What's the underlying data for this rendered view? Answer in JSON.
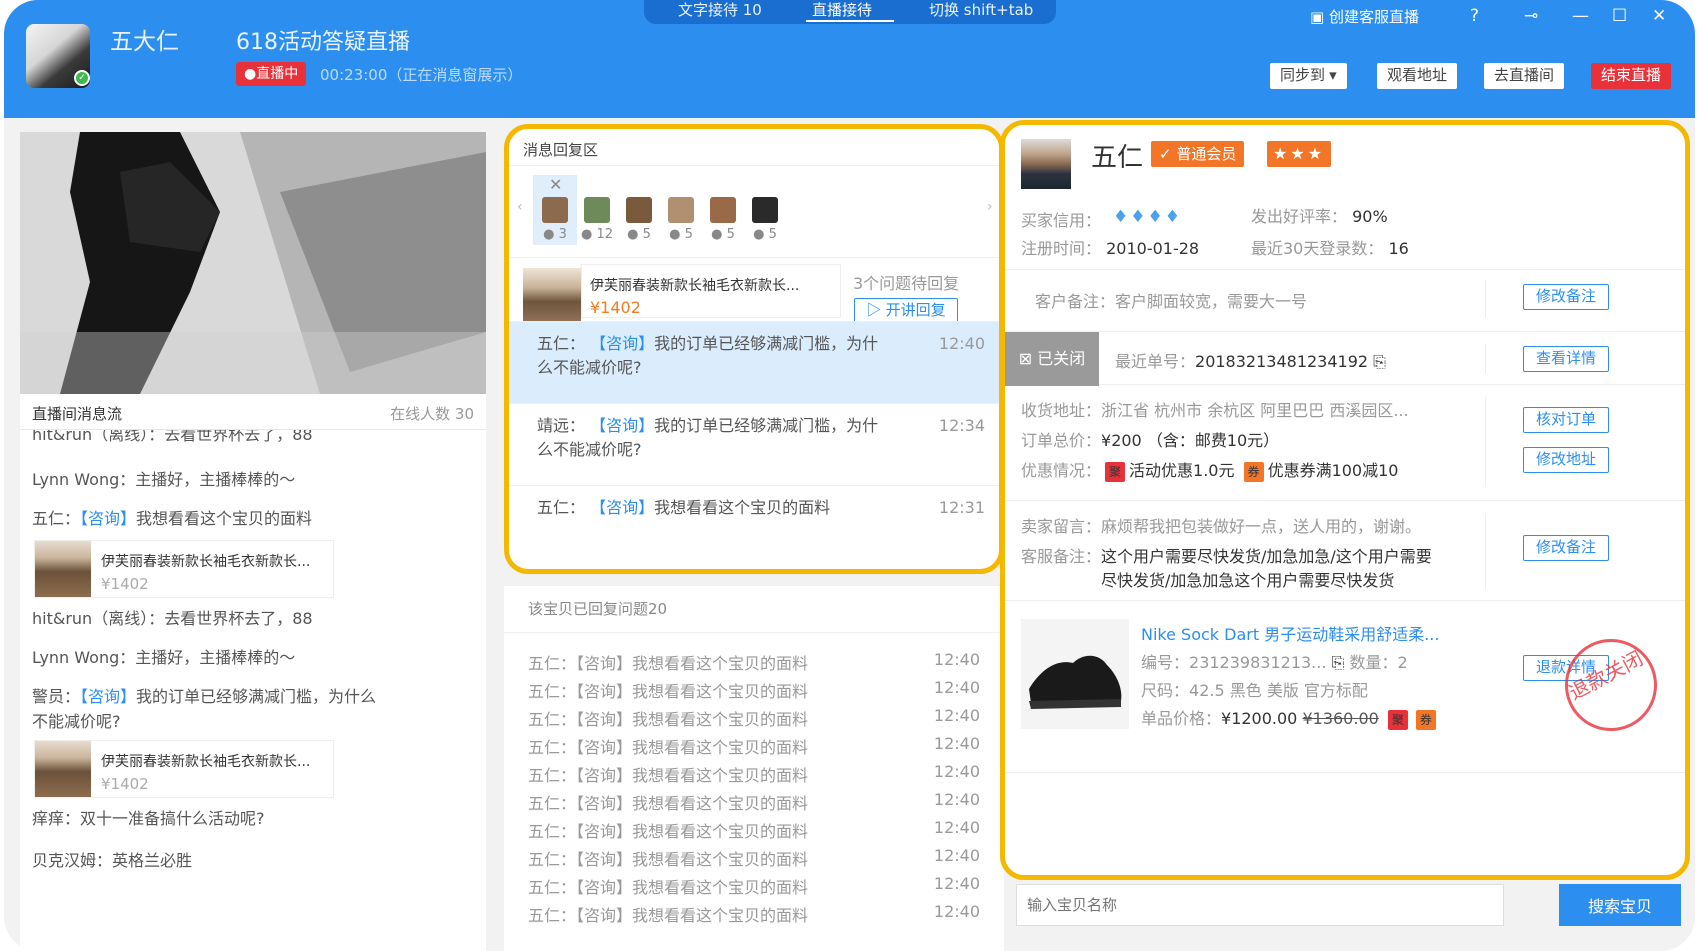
{
  "header": {
    "user_name": "五大仁",
    "live_title": "618活动答疑直播",
    "live_badge": "●直播中",
    "live_time": "00:23:00（正在消息窗展示）",
    "tabs": [
      {
        "label": "文字接待 10"
      },
      {
        "label": "直播接待"
      },
      {
        "label": "切换  shift+tab"
      }
    ],
    "create_live": "创建客服直播",
    "window_icons": [
      "help-icon",
      "pin-icon",
      "minimize-icon",
      "maximize-icon",
      "close-icon"
    ],
    "buttons": {
      "sync": "同步到 ▾",
      "watch": "观看地址",
      "go_room": "去直播间",
      "end": "结束直播"
    }
  },
  "left": {
    "feed_title": "直播间消息流",
    "online": "在线人数 30",
    "messages": [
      {
        "text": "hit&run（离线）：去看世界杯去了，88"
      },
      {
        "text": "Lynn Wong：主播好，主播棒棒的～"
      },
      {
        "user": "五仁：",
        "tag": "【咨询】",
        "text": "我想看看这个宝贝的面料"
      },
      {
        "text": "hit&run（离线）：去看世界杯去了，88"
      },
      {
        "text": "Lynn Wong：主播好，主播棒棒的～"
      },
      {
        "user": "警员：",
        "tag": "【咨询】",
        "text": "我的订单已经够满减门槛，为什么不能减价呢?"
      },
      {
        "text": "痒痒：双十一准备搞什么活动呢?"
      },
      {
        "text": "贝克汉姆：英格兰必胜"
      }
    ],
    "product_card": {
      "title": "伊芙丽春装新款长袖毛衣新款长...",
      "price": "¥1402"
    }
  },
  "middle": {
    "reply_title": "消息回复区",
    "thumbs": [
      {
        "count": "3",
        "color": "#8b6a4e"
      },
      {
        "count": "12",
        "color": "#6f8a5a"
      },
      {
        "count": "5",
        "color": "#7a5a3c"
      },
      {
        "count": "5",
        "color": "#b09070"
      },
      {
        "count": "5",
        "color": "#9a6a48"
      },
      {
        "count": "5",
        "color": "#2a2a2a"
      }
    ],
    "product": {
      "name": "伊芙丽春装新款长袖毛衣新款长...",
      "price": "¥1402"
    },
    "pending": "3个问题待回复",
    "open_reply": "开讲回复",
    "questions": [
      {
        "user": "五仁：",
        "tag": "【咨询】",
        "text": "我的订单已经够满减门槛，为什么不能减价呢?",
        "time": "12:40"
      },
      {
        "user": "靖远：",
        "tag": "【咨询】",
        "text": "我的订单已经够满减门槛，为什么不能减价呢?",
        "time": "12:34"
      },
      {
        "user": "五仁：",
        "tag": "【咨询】",
        "text": "我想看看这个宝贝的面料",
        "time": "12:31"
      }
    ],
    "answered_title": "该宝贝已回复问题20",
    "answered": [
      {
        "text": "五仁：【咨询】我想看看这个宝贝的面料",
        "time": "12:40"
      },
      {
        "text": "五仁：【咨询】我想看看这个宝贝的面料",
        "time": "12:40"
      },
      {
        "text": "五仁：【咨询】我想看看这个宝贝的面料",
        "time": "12:40"
      },
      {
        "text": "五仁：【咨询】我想看看这个宝贝的面料",
        "time": "12:40"
      },
      {
        "text": "五仁：【咨询】我想看看这个宝贝的面料",
        "time": "12:40"
      },
      {
        "text": "五仁：【咨询】我想看看这个宝贝的面料",
        "time": "12:40"
      },
      {
        "text": "五仁：【咨询】我想看看这个宝贝的面料",
        "time": "12:40"
      },
      {
        "text": "五仁：【咨询】我想看看这个宝贝的面料",
        "time": "12:40"
      },
      {
        "text": "五仁：【咨询】我想看看这个宝贝的面料",
        "time": "12:40"
      },
      {
        "text": "五仁：【咨询】我想看看这个宝贝的面料",
        "time": "12:40"
      }
    ]
  },
  "customer": {
    "name": "五仁",
    "member": "✓ 普通会员",
    "stars": "★★★",
    "credit_label": "买家信用：",
    "diamonds": "♦♦♦♦",
    "good_rate_label": "发出好评率：",
    "good_rate": "90%",
    "reg_label": "注册时间：",
    "reg": "2010-01-28",
    "login_label": "最近30天登录数：",
    "login": "16",
    "remark_label": "客户备注：",
    "remark": "客户脚面较宽，需要大一号",
    "remark_btn": "修改备注"
  },
  "order": {
    "status": "已关闭",
    "no_label": "最近单号：",
    "no": "20183213481234192",
    "detail_btn": "查看详情",
    "addr_label": "收货地址：",
    "addr": "浙江省 杭州市 余杭区 阿里巴巴 西溪园区...",
    "total_label": "订单总价：",
    "total": "¥200 （含：邮费10元）",
    "discount_label": "优惠情况：",
    "tag1": "聚",
    "disc1": "活动优惠1.0元",
    "tag2": "券",
    "disc2": "优惠券满100减10",
    "check_btn": "核对订单",
    "addr_btn": "修改地址",
    "seller_msg_label": "卖家留言：",
    "seller_msg": "麻烦帮我把包装做好一点，送人用的，谢谢。",
    "svc_label": "客服备注：",
    "svc_1": "这个用户需要尽快发货/加急加急/这个用户需要",
    "svc_2": "尽快发货/加急加急这个用户需要尽快发货",
    "svc_btn": "修改备注",
    "item": {
      "title": "Nike Sock Dart 男子运动鞋采用舒适柔...",
      "code_label": "编号：",
      "code": "231239831213...",
      "qty_label": "数量：",
      "qty": "2",
      "size_label": "尺码：",
      "size": "42.5 黑色 美版 官方标配",
      "price_label": "单品价格：",
      "price": "¥1200.00",
      "old_price": "¥1360.00",
      "refund_btn": "退款详情",
      "stamp": "退款关闭"
    }
  },
  "search": {
    "placeholder": "输入宝贝名称",
    "button": "搜索宝贝"
  }
}
